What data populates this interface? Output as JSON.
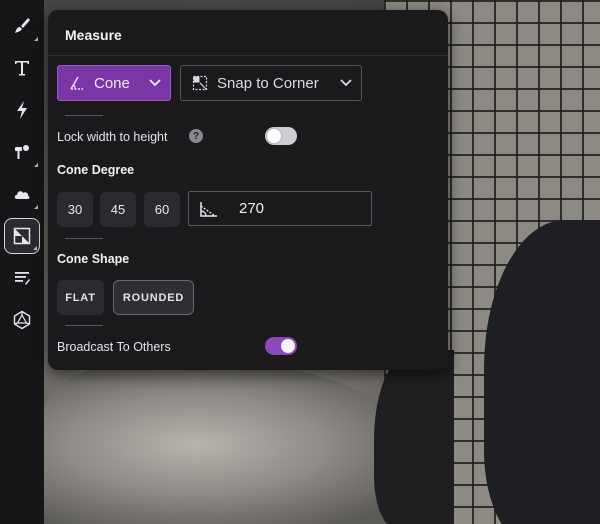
{
  "panel": {
    "title": "Measure"
  },
  "shape_dropdown": {
    "value": "Cone",
    "icon": "cone-angle-icon"
  },
  "snap_dropdown": {
    "value": "Snap to Corner",
    "icon": "snap-corner-icon"
  },
  "lock_width": {
    "label": "Lock width to height",
    "help": "?",
    "enabled": false
  },
  "cone_degree": {
    "label": "Cone Degree",
    "presets": [
      "30",
      "45",
      "60"
    ],
    "value": "270"
  },
  "cone_shape": {
    "label": "Cone Shape",
    "options": [
      "FLAT",
      "ROUNDED"
    ],
    "selected": "ROUNDED"
  },
  "broadcast": {
    "label": "Broadcast To Others",
    "enabled": true
  },
  "toolbar": {
    "tools": [
      "brush-icon",
      "text-icon",
      "lightning-icon",
      "paint-icon",
      "cloud-icon",
      "measure-icon",
      "notes-icon",
      "d20-icon"
    ],
    "active": "measure-icon"
  },
  "colors": {
    "accent": "#7b36a6",
    "panel_bg": "#1b191c",
    "toolbar_bg": "#161518"
  }
}
